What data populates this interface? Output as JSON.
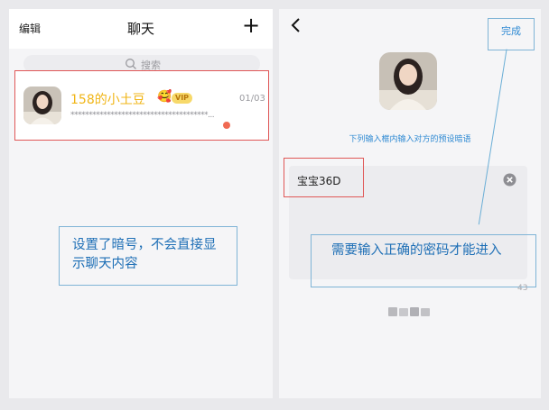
{
  "left": {
    "header": {
      "edit_label": "编辑",
      "title": "聊天",
      "add_label": "+"
    },
    "search": {
      "placeholder": "搜索",
      "icon": "search-icon"
    },
    "chat_row": {
      "name": "158的小土豆",
      "emoji": "🥰",
      "vip_label": "VIP",
      "date": "01/03",
      "preview": "**************************************...",
      "unread": true
    },
    "annotation": "设置了暗号，不会直接显示聊天内容"
  },
  "right": {
    "back_icon": "chevron-left-icon",
    "done_label": "完成",
    "hint": "下列输入框内输入对方的预设暗语",
    "input_value": "宝宝36D",
    "clear_icon": "clear-icon",
    "annotation": "需要输入正确的密码才能进入",
    "char_count": "43"
  },
  "colors": {
    "accent_blue": "#2f8ad3",
    "annotation_red": "#e05757",
    "name_gold": "#f0b516",
    "unread_dot": "#f06a53",
    "page_bg": "#f5f5f7"
  }
}
